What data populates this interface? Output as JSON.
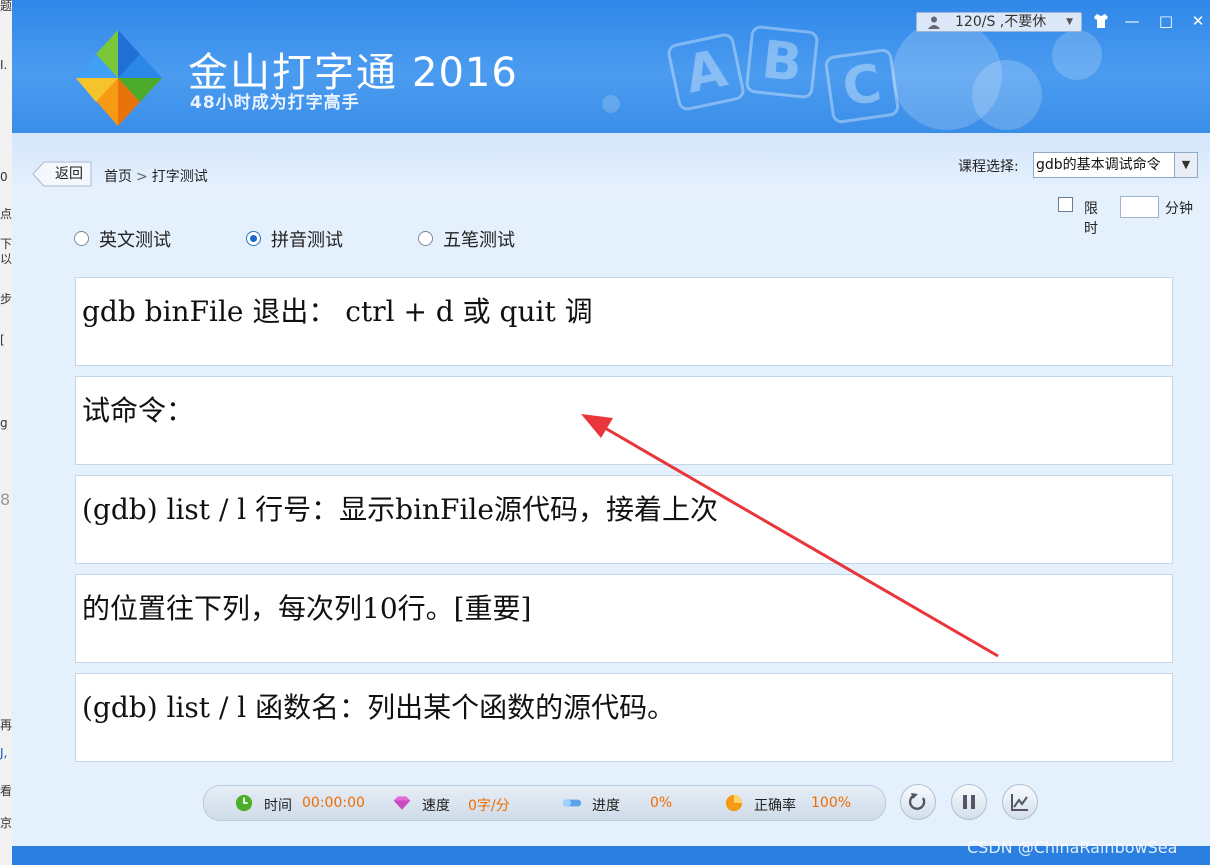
{
  "background_window": {
    "fragments": [
      "题",
      "I.",
      "0",
      "点",
      "下",
      "以",
      "步",
      "[",
      "g",
      "8",
      "再",
      "J,",
      "看",
      "京"
    ]
  },
  "titlebar": {
    "brand": "金山打字通",
    "year": "2016",
    "slogan": "48小时成为打字高手",
    "decor_letters": [
      "A",
      "B",
      "C"
    ],
    "user_status": "120/S ,不要休",
    "buttons": {
      "skin": "shirt-icon",
      "min": "—",
      "max": "□",
      "close": "✕"
    }
  },
  "nav": {
    "back_label": "返回",
    "breadcrumb": {
      "home": "首页",
      "separator": ">",
      "current": "打字测试"
    },
    "course_label": "课程选择:",
    "course_value": "gdb的基本调试命令",
    "limit_label": "限时",
    "limit_value": "",
    "minutes_label": "分钟"
  },
  "modes": [
    {
      "label": "英文测试",
      "selected": false
    },
    {
      "label": "拼音测试",
      "selected": true
    },
    {
      "label": "五笔测试",
      "selected": false
    }
  ],
  "lines": [
    "gdb binFile 退出： ctrl + d 或 quit 调",
    "试命令：",
    "(gdb) list / l 行号：显示binFile源代码，接着上次",
    "的位置往下列，每次列10行。[重要]",
    "(gdb) list / l 函数名：列出某个函数的源代码。"
  ],
  "status": {
    "time_label": "时间",
    "time_value": "00:00:00",
    "speed_label": "速度",
    "speed_value": "0字/分",
    "progress_label": "进度",
    "progress_value": "0%",
    "progress_fraction": 0,
    "accuracy_label": "正确率",
    "accuracy_value": "100%"
  },
  "controls": {
    "restart": "restart-icon",
    "pause": "pause-icon",
    "chart": "chart-icon"
  },
  "watermark": "CSDN @ChinaRainbowSea",
  "colors": {
    "title_blue": "#3a8ee8",
    "accent_orange": "#ef6c00",
    "arrow_red": "#e8363a"
  }
}
